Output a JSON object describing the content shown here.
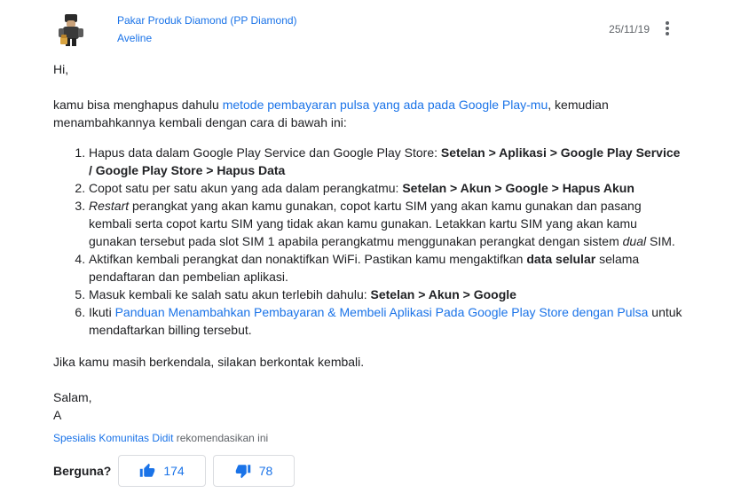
{
  "post": {
    "author": "Pakar Produk Diamond (PP Diamond)",
    "role": "Aveline",
    "date": "25/11/19",
    "menu_icon": "more-vert-icon"
  },
  "message": {
    "greeting": "Hi,",
    "intro_pre": "kamu bisa menghapus dahulu ",
    "intro_link": "metode pembayaran pulsa yang ada pada Google Play-mu",
    "intro_post": ", kemudian menambahkannya kembali dengan cara di bawah ini:",
    "steps": {
      "s1_text": "Hapus data dalam Google Play Service dan Google Play Store: ",
      "s1_bold": "Setelan > Aplikasi > Google Play Service / Google Play Store > Hapus Data",
      "s2_text": "Copot satu per satu akun yang ada dalam perangkatmu: ",
      "s2_bold": "Setelan > Akun > Google > Hapus Akun",
      "s3_italic": "Restart",
      "s3_text": " perangkat yang akan kamu gunakan, copot kartu SIM yang akan kamu gunakan dan pasang kembali serta copot kartu SIM yang tidak akan kamu gunakan. Letakkan kartu SIM yang akan kamu gunakan tersebut pada slot SIM 1 apabila perangkatmu menggunakan perangkat dengan sistem ",
      "s3_italic2": "dual",
      "s3_end": " SIM.",
      "s4_text": "Aktifkan kembali perangkat dan nonaktifkan WiFi. Pastikan kamu mengaktifkan ",
      "s4_bold": "data selular",
      "s4_end": " selama pendaftaran dan pembelian aplikasi.",
      "s5_text": "Masuk kembali ke salah satu akun terlebih dahulu: ",
      "s5_bold": "Setelan > Akun > Google",
      "s6_text": "Ikuti ",
      "s6_link": "Panduan Menambahkan Pembayaran & Membeli Aplikasi Pada Google Play Store dengan Pulsa",
      "s6_end": " untuk mendaftarkan billing tersebut."
    },
    "closing": "Jika kamu masih berkendala, silakan berkontak kembali.",
    "salutation": "Salam,",
    "signature": "A"
  },
  "recommendation": {
    "role": "Spesialis Komunitas",
    "name": "Didit",
    "text": "rekomendasikan ini"
  },
  "helpful": {
    "label": "Berguna?",
    "up_count": "174",
    "down_count": "78",
    "up_icon": "thumb-up-icon",
    "down_icon": "thumb-down-icon",
    "accent": "#1a73e8"
  }
}
